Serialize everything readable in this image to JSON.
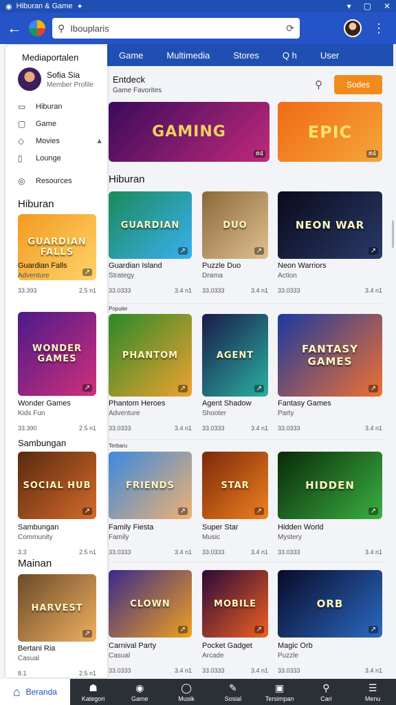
{
  "statusbar": {
    "title": "Hiburan & Game",
    "wifi": "▾",
    "close": "✕"
  },
  "address": {
    "back": "←",
    "query": "Ibouplaris",
    "reload": "⟳",
    "menu": "⋮"
  },
  "topnav": [
    "Game",
    "Multimedia",
    "Stores",
    "Q h",
    "User"
  ],
  "sidebar": {
    "title": "Mediaportalen",
    "profile_name": "Sofia Sia",
    "profile_sub": "Member Profile",
    "menu": [
      {
        "label": "Hiburan",
        "icon": "▭"
      },
      {
        "label": "Game",
        "icon": "▢"
      },
      {
        "label": "Movies",
        "icon": "◇",
        "pin": "▲"
      },
      {
        "label": "Lounge",
        "icon": "▯"
      },
      {
        "label": "Resources",
        "icon": "◎"
      }
    ],
    "sections": [
      "Hiburan",
      "Sambungan",
      "Mainan"
    ]
  },
  "main": {
    "header_title": "Entdeck",
    "header_sub": "Game Favorites",
    "button_label": "Sodes",
    "section_title": "Hiburan",
    "small_labels": [
      "Populer",
      "Terbaru"
    ]
  },
  "banners": [
    {
      "text": "GAMING",
      "grad": "#3b0a5c,#c02a7a"
    },
    {
      "text": "EPIC",
      "grad": "#f06b14,#f5a63a"
    }
  ],
  "side_games": [
    {
      "art": "GUARDIAN FALLS",
      "title": "Guardian Falls",
      "sub": "Adventure",
      "meta_l": "33.393",
      "meta_r": "2.5 n1",
      "grad": "#f29b21,#ffd36a"
    },
    {
      "art": "WONDER GAMES",
      "title": "Wonder Games",
      "sub": "Kids Fun",
      "meta_l": "33.390",
      "meta_r": "2.5 n1",
      "grad": "#4b1a8a,#d0307a"
    },
    {
      "art": "SOCIAL HUB",
      "title": "Sambungan",
      "sub": "Community",
      "meta_l": "3.3",
      "meta_r": "2.5 n1",
      "grad": "#5a2a10,#d46a2a"
    },
    {
      "art": "HARVEST",
      "title": "Bertani Ria",
      "sub": "Casual",
      "meta_l": "8.1",
      "meta_r": "2.5 n1",
      "grad": "#6b4a2a,#f0b060"
    }
  ],
  "grid_games": [
    {
      "art": "GUARDIAN",
      "title": "Guardian Island",
      "sub": "Strategy",
      "meta_l": "33.0333",
      "meta_r": "3.4 n1",
      "grad": "#1a8a5a,#3ab0f0"
    },
    {
      "art": "DUO",
      "title": "Puzzle Duo",
      "sub": "Drama",
      "meta_l": "33.0333",
      "meta_r": "3.4 n1",
      "grad": "#8a6a3a,#e0c090"
    },
    {
      "art": "NEON WAR",
      "title": "Neon Warriors",
      "sub": "Action",
      "meta_l": "33.0333",
      "meta_r": "3.4 n1",
      "grad": "#0a0a1a,#2a3a6a"
    },
    {
      "art": "PHANTOM",
      "title": "Phantom Heroes",
      "sub": "Adventure",
      "meta_l": "33.0333",
      "meta_r": "3.4 n1",
      "grad": "#2a8a2a,#f0a030"
    },
    {
      "art": "AGENT",
      "title": "Agent Shadow",
      "sub": "Shooter",
      "meta_l": "33.0333",
      "meta_r": "3.4 n1",
      "grad": "#1a1a4a,#2ab0a0"
    },
    {
      "art": "FANTASY GAMES",
      "title": "Fantasy Games",
      "sub": "Party",
      "meta_l": "33.0333",
      "meta_r": "3.4 n1",
      "grad": "#1a3aa0,#f07030"
    },
    {
      "art": "FRIENDS",
      "title": "Family Fiesta",
      "sub": "Family",
      "meta_l": "33.0333",
      "meta_r": "3.4 n1",
      "grad": "#3a8ae0,#f0b070"
    },
    {
      "art": "STAR",
      "title": "Super Star",
      "sub": "Music",
      "meta_l": "33.0333",
      "meta_r": "3.4 n1",
      "grad": "#7a2a0a,#f08020"
    },
    {
      "art": "HIDDEN",
      "title": "Hidden World",
      "sub": "Mystery",
      "meta_l": "33.0333",
      "meta_r": "3.4 n1",
      "grad": "#0a2a0a,#3ab040"
    },
    {
      "art": "CLOWN",
      "title": "Carnival Party",
      "sub": "Casual",
      "meta_l": "33.0333",
      "meta_r": "3.4 n1",
      "grad": "#3a2a8a,#f0a020"
    },
    {
      "art": "MOBILE",
      "title": "Pocket Gadget",
      "sub": "Arcade",
      "meta_l": "33.0333",
      "meta_r": "3.4 n1",
      "grad": "#2a0a3a,#f06020"
    },
    {
      "art": "ORB",
      "title": "Magic Orb",
      "sub": "Puzzle",
      "meta_l": "33.0333",
      "meta_r": "3.4 n1",
      "grad": "#0a0a2a,#2a6ac0"
    }
  ],
  "bottombar": [
    {
      "label": "Beranda",
      "icon": "⌂",
      "active": true
    },
    {
      "label": "Kategori",
      "icon": "☗"
    },
    {
      "label": "Game",
      "icon": "◉"
    },
    {
      "label": "Musik",
      "icon": "◯"
    },
    {
      "label": "Sosial",
      "icon": "✎"
    },
    {
      "label": "Tersimpan",
      "icon": "▣"
    },
    {
      "label": "Cari",
      "icon": "⚲"
    },
    {
      "label": "Menu",
      "icon": "☰"
    }
  ]
}
